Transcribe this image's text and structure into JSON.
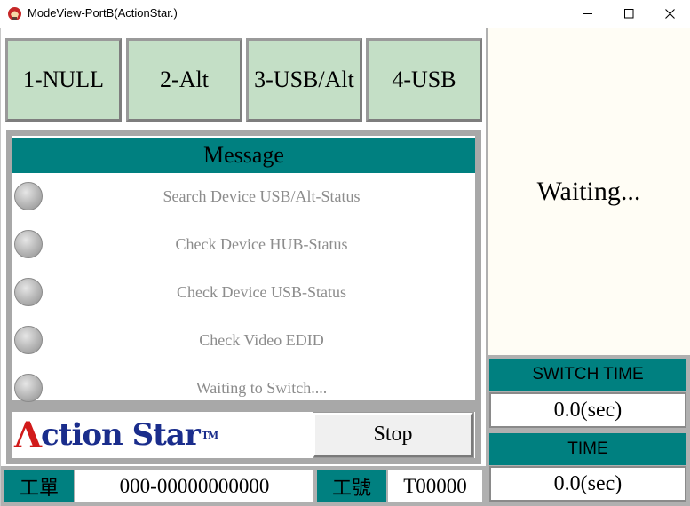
{
  "window": {
    "title": "ModeView-PortB(ActionStar.)"
  },
  "modes": [
    {
      "label": "1-NULL"
    },
    {
      "label": "2-Alt"
    },
    {
      "label": "3-USB/Alt"
    },
    {
      "label": "4-USB"
    }
  ],
  "message": {
    "header": "Message",
    "items": [
      {
        "text": "Search Device USB/Alt-Status"
      },
      {
        "text": "Check Device HUB-Status"
      },
      {
        "text": "Check Device USB-Status"
      },
      {
        "text": "Check Video EDID"
      },
      {
        "text": "Waiting to Switch...."
      }
    ]
  },
  "logo": {
    "text": "Action Star",
    "tm": "TM"
  },
  "stop_label": "Stop",
  "work_order": {
    "label": "工單",
    "value": "000-00000000000"
  },
  "work_number": {
    "label": "工號",
    "value": "T00000"
  },
  "status_text": "Waiting...",
  "switch_time": {
    "label": "SWITCH TIME",
    "value": "0.0(sec)"
  },
  "time": {
    "label": "TIME",
    "value": "0.0(sec)"
  },
  "colors": {
    "teal": "#008080",
    "mode_button": "#c4dfc6",
    "status_background": "#fffdf5",
    "logo_blue": "#1a2d8c",
    "logo_red": "#d11a1a"
  }
}
